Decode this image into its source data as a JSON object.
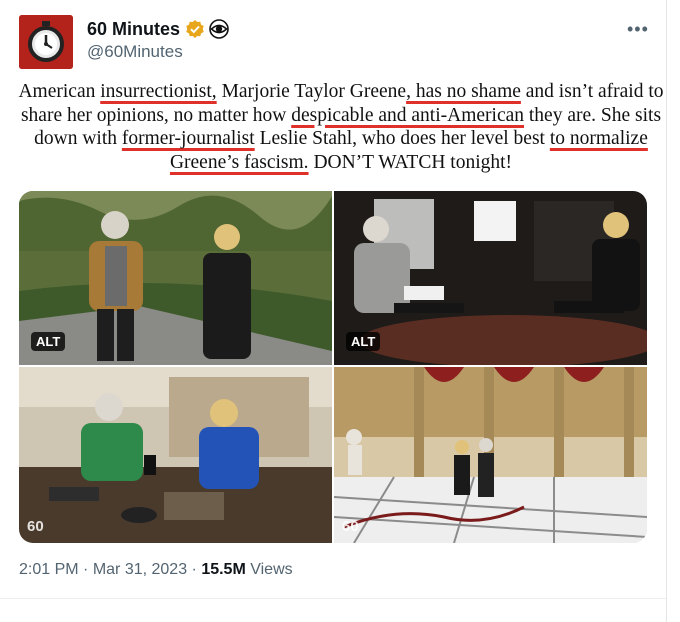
{
  "account": {
    "name": "60 Minutes",
    "handle": "@60Minutes",
    "verified_color": "#e8a61c"
  },
  "tweet": {
    "segments": [
      {
        "text": "American ",
        "hl": false
      },
      {
        "text": "insurrectionist,",
        "hl": true
      },
      {
        "text": " Marjorie Taylor Greene",
        "hl": false
      },
      {
        "text": ", has no shame",
        "hl": true
      },
      {
        "text": " and isn’t afraid to share her opinions, no matter how ",
        "hl": false
      },
      {
        "text": "despicable and anti-American",
        "hl": true
      },
      {
        "text": " they are. She sits down with ",
        "hl": false
      },
      {
        "text": "former-journalist",
        "hl": true
      },
      {
        "text": " Leslie Stahl, who does her level best ",
        "hl": false
      },
      {
        "text": "to normalize Greene’s fascism.",
        "hl": true
      },
      {
        "text": " DON’T WATCH  tonight!",
        "hl": false
      }
    ],
    "highlight_color": "#e0302a"
  },
  "media": {
    "alt_label": "ALT",
    "watermark": "60",
    "images": [
      {
        "name": "two women walking outdoors",
        "has_alt": true
      },
      {
        "name": "interview in studio chairs",
        "has_alt": true
      },
      {
        "name": "women looking at phone at table",
        "has_alt": false
      },
      {
        "name": "two women in capitol statuary hall",
        "has_alt": false
      }
    ]
  },
  "meta": {
    "time": "2:01 PM",
    "sep1": " · ",
    "date": "Mar 31, 2023",
    "sep2": " · ",
    "views_count": "15.5M",
    "views_label": " Views"
  },
  "icons": [
    "more-icon",
    "verified-badge-icon",
    "cbs-eye-icon",
    "stopwatch-icon"
  ]
}
